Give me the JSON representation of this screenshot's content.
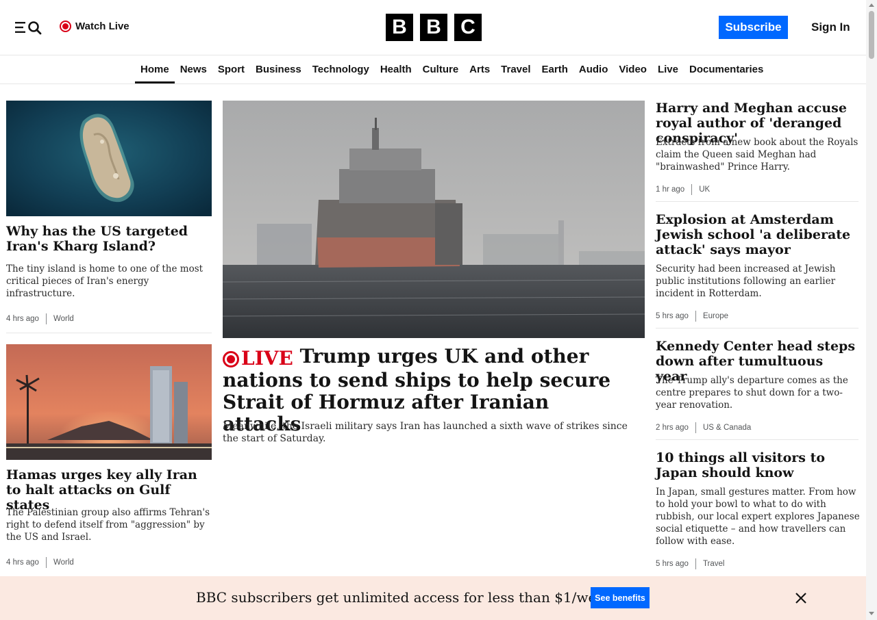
{
  "header": {
    "watch_live": "Watch Live",
    "logo_letters": [
      "B",
      "B",
      "C"
    ],
    "subscribe": "Subscribe",
    "sign_in": "Sign In",
    "menu_icon": "menu-search-icon"
  },
  "nav": {
    "items": [
      "Home",
      "News",
      "Sport",
      "Business",
      "Technology",
      "Health",
      "Culture",
      "Arts",
      "Travel",
      "Earth",
      "Audio",
      "Video",
      "Live",
      "Documentaries"
    ],
    "active": "Home"
  },
  "left": {
    "stories": [
      {
        "headline": "Why has the US targeted Iran's Kharg Island?",
        "summary": "The tiny island is home to one of the most critical pieces of Iran's energy infrastructure.",
        "time": "4 hrs ago",
        "section": "World"
      },
      {
        "headline": "Hamas urges key ally Iran to halt attacks on Gulf states",
        "summary": "The Palestinian group also affirms Tehran's right to defend itself from \"aggression\" by the US and Israel.",
        "time": "4 hrs ago",
        "section": "World"
      }
    ]
  },
  "main": {
    "live_label": "LIVE",
    "headline": "Trump urges UK and other nations to send ships to help secure Strait of Hormuz after Iranian attacks",
    "summary": "Meanwhile, the Israeli military says Iran has launched a sixth wave of strikes since the start of Saturday."
  },
  "right": {
    "stories": [
      {
        "headline": "Harry and Meghan accuse royal author of 'deranged conspiracy'",
        "summary": "Extracts from a new book about the Royals claim the Queen said Meghan had \"brainwashed\" Prince Harry.",
        "time": "1 hr ago",
        "section": "UK"
      },
      {
        "headline": "Explosion at Amsterdam Jewish school 'a deliberate attack' says mayor",
        "summary": "Security had been increased at Jewish public institutions following an earlier incident in Rotterdam.",
        "time": "5 hrs ago",
        "section": "Europe"
      },
      {
        "headline": "Kennedy Center head steps down after tumultuous year",
        "summary": "The Trump ally's departure comes as the centre prepares to shut down for a two-year renovation.",
        "time": "2 hrs ago",
        "section": "US & Canada"
      },
      {
        "headline": "10 things all visitors to Japan should know",
        "summary": "In Japan, small gestures matter. From how to hold your bowl to what to do with rubbish, our local expert explores Japanese social etiquette – and how travellers can follow with ease.",
        "time": "5 hrs ago",
        "section": "Travel"
      }
    ]
  },
  "banner": {
    "text": "BBC subscribers get unlimited access for less than $1/week",
    "button": "See benefits"
  },
  "colors": {
    "brand_blue": "#0068ff",
    "live_red": "#d90017",
    "banner_bg": "#fbe9e1"
  }
}
